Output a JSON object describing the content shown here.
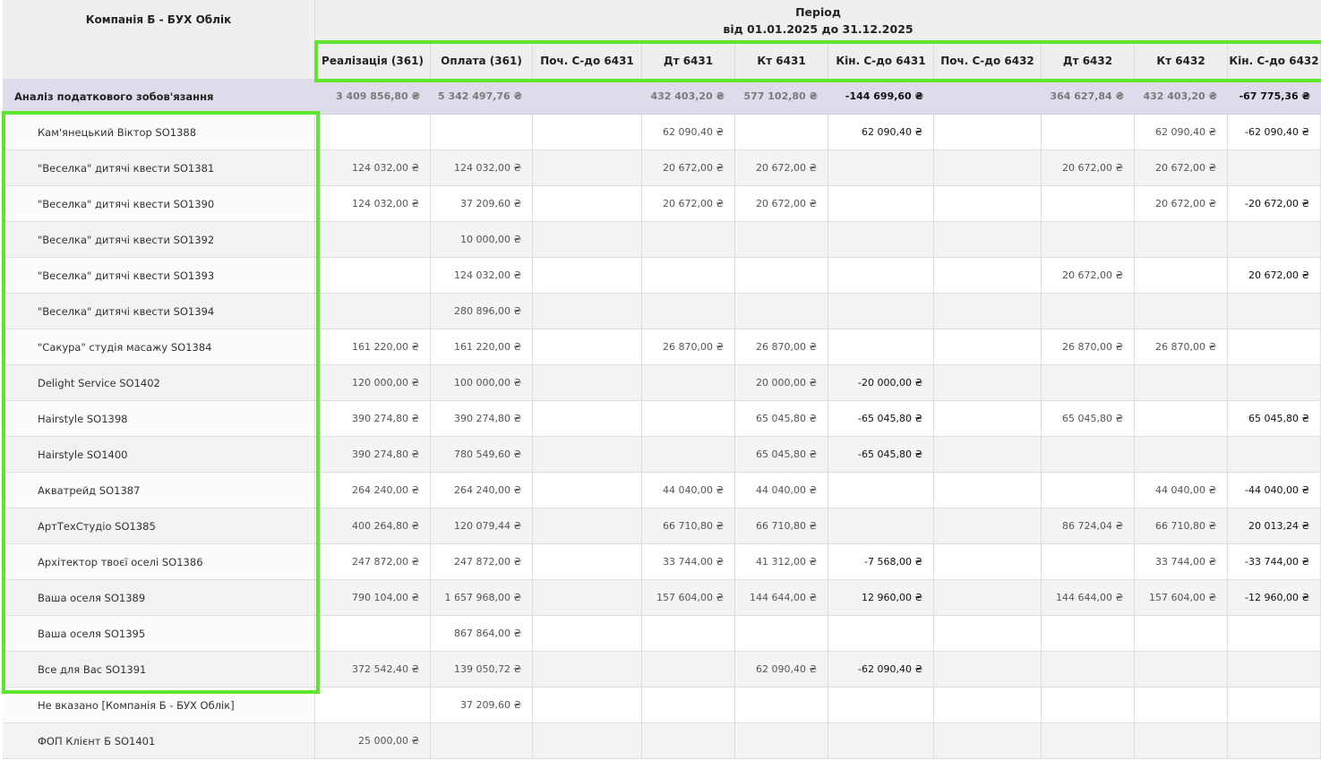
{
  "header": {
    "company": "Компанія Б - БУХ Облік",
    "period_label": "Період",
    "period_range": "від 01.01.2025 до 31.12.2025",
    "columns": [
      "Реалізація (361)",
      "Оплата (361)",
      "Поч. С-до 6431",
      "Дт 6431",
      "Кт 6431",
      "Кін. С-до 6431",
      "Поч. С-до 6432",
      "Дт 6432",
      "Кт 6432",
      "Кін. С-до 6432"
    ]
  },
  "totals": {
    "label": "Аналіз податкового зобов'язання",
    "values": [
      "3 409 856,80 ₴",
      "5 342 497,76 ₴",
      "",
      "432 403,20 ₴",
      "577 102,80 ₴",
      "-144 699,60 ₴",
      "",
      "364 627,84 ₴",
      "432 403,20 ₴",
      "-67 775,36 ₴"
    ]
  },
  "rows": [
    {
      "name": "Кам'янецький Віктор SO1388",
      "values": [
        "",
        "",
        "",
        "62 090,40 ₴",
        "",
        "62 090,40 ₴",
        "",
        "",
        "62 090,40 ₴",
        "-62 090,40 ₴"
      ]
    },
    {
      "name": "\"Веселка\" дитячі квести SO1381",
      "values": [
        "124 032,00 ₴",
        "124 032,00 ₴",
        "",
        "20 672,00 ₴",
        "20 672,00 ₴",
        "",
        "",
        "20 672,00 ₴",
        "20 672,00 ₴",
        ""
      ]
    },
    {
      "name": "\"Веселка\" дитячі квести SO1390",
      "values": [
        "124 032,00 ₴",
        "37 209,60 ₴",
        "",
        "20 672,00 ₴",
        "20 672,00 ₴",
        "",
        "",
        "",
        "20 672,00 ₴",
        "-20 672,00 ₴"
      ]
    },
    {
      "name": "\"Веселка\" дитячі квести SO1392",
      "values": [
        "",
        "10 000,00 ₴",
        "",
        "",
        "",
        "",
        "",
        "",
        "",
        ""
      ]
    },
    {
      "name": "\"Веселка\" дитячі квести SO1393",
      "values": [
        "",
        "124 032,00 ₴",
        "",
        "",
        "",
        "",
        "",
        "20 672,00 ₴",
        "",
        "20 672,00 ₴"
      ]
    },
    {
      "name": "\"Веселка\" дитячі квести SO1394",
      "values": [
        "",
        "280 896,00 ₴",
        "",
        "",
        "",
        "",
        "",
        "",
        "",
        ""
      ]
    },
    {
      "name": "\"Сакура\" студія масажу SO1384",
      "values": [
        "161 220,00 ₴",
        "161 220,00 ₴",
        "",
        "26 870,00 ₴",
        "26 870,00 ₴",
        "",
        "",
        "26 870,00 ₴",
        "26 870,00 ₴",
        ""
      ]
    },
    {
      "name": "Delight Service SO1402",
      "values": [
        "120 000,00 ₴",
        "100 000,00 ₴",
        "",
        "",
        "20 000,00 ₴",
        "-20 000,00 ₴",
        "",
        "",
        "",
        ""
      ]
    },
    {
      "name": "Hairstyle SO1398",
      "values": [
        "390 274,80 ₴",
        "390 274,80 ₴",
        "",
        "",
        "65 045,80 ₴",
        "-65 045,80 ₴",
        "",
        "65 045,80 ₴",
        "",
        "65 045,80 ₴"
      ]
    },
    {
      "name": "Hairstyle SO1400",
      "values": [
        "390 274,80 ₴",
        "780 549,60 ₴",
        "",
        "",
        "65 045,80 ₴",
        "-65 045,80 ₴",
        "",
        "",
        "",
        ""
      ]
    },
    {
      "name": "Акватрейд SO1387",
      "values": [
        "264 240,00 ₴",
        "264 240,00 ₴",
        "",
        "44 040,00 ₴",
        "44 040,00 ₴",
        "",
        "",
        "",
        "44 040,00 ₴",
        "-44 040,00 ₴"
      ]
    },
    {
      "name": "АртТехСтудіо SO1385",
      "values": [
        "400 264,80 ₴",
        "120 079,44 ₴",
        "",
        "66 710,80 ₴",
        "66 710,80 ₴",
        "",
        "",
        "86 724,04 ₴",
        "66 710,80 ₴",
        "20 013,24 ₴"
      ]
    },
    {
      "name": "Архітектор твоєї оселі SO1386",
      "values": [
        "247 872,00 ₴",
        "247 872,00 ₴",
        "",
        "33 744,00 ₴",
        "41 312,00 ₴",
        "-7 568,00 ₴",
        "",
        "",
        "33 744,00 ₴",
        "-33 744,00 ₴"
      ]
    },
    {
      "name": "Ваша оселя SO1389",
      "values": [
        "790 104,00 ₴",
        "1 657 968,00 ₴",
        "",
        "157 604,00 ₴",
        "144 644,00 ₴",
        "12 960,00 ₴",
        "",
        "144 644,00 ₴",
        "157 604,00 ₴",
        "-12 960,00 ₴"
      ]
    },
    {
      "name": "Ваша оселя SO1395",
      "values": [
        "",
        "867 864,00 ₴",
        "",
        "",
        "",
        "",
        "",
        "",
        "",
        ""
      ]
    },
    {
      "name": "Все для Вас SO1391",
      "values": [
        "372 542,40 ₴",
        "139 050,72 ₴",
        "",
        "",
        "62 090,40 ₴",
        "-62 090,40 ₴",
        "",
        "",
        "",
        ""
      ]
    },
    {
      "name": "Не вказано [Компанія Б - БУХ Облік]",
      "values": [
        "",
        "37 209,60 ₴",
        "",
        "",
        "",
        "",
        "",
        "",
        "",
        ""
      ]
    },
    {
      "name": "ФОП Клієнт Б SO1401",
      "values": [
        "25 000,00 ₴",
        "",
        "",
        "",
        "",
        "",
        "",
        "",
        "",
        ""
      ]
    }
  ],
  "highlight_color": "#5ce62d"
}
